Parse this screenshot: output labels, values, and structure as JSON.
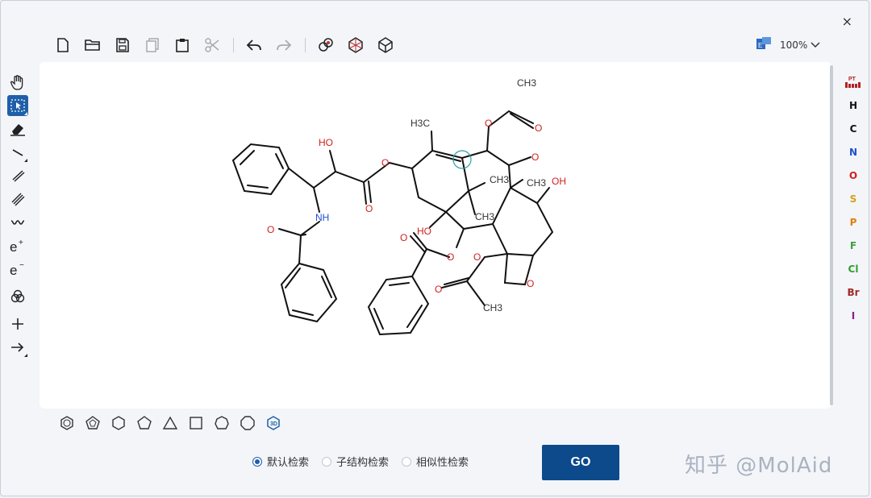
{
  "window": {
    "close_symbol": "×"
  },
  "toolbar": {
    "icons": [
      "new-file-icon",
      "open-folder-icon",
      "save-icon",
      "copy-icon",
      "paste-icon",
      "cut-icon",
      "undo-icon",
      "redo-icon",
      "clean-structure-icon",
      "3d-view-icon",
      "3d-rotate-icon"
    ]
  },
  "zoom": {
    "value": "100%"
  },
  "left_tools": [
    "hand-pan",
    "select",
    "eraser",
    "single-bond",
    "double-bond",
    "triple-bond",
    "wavy-bond",
    "charge-plus",
    "charge-minus",
    "rings",
    "add",
    "arrow"
  ],
  "elements": [
    {
      "symbol": "PT",
      "color": "#b22222"
    },
    {
      "symbol": "H",
      "color": "#111111"
    },
    {
      "symbol": "C",
      "color": "#111111"
    },
    {
      "symbol": "N",
      "color": "#2050d0"
    },
    {
      "symbol": "O",
      "color": "#d02020"
    },
    {
      "symbol": "S",
      "color": "#d4a018"
    },
    {
      "symbol": "P",
      "color": "#e08010"
    },
    {
      "symbol": "F",
      "color": "#40a040"
    },
    {
      "symbol": "Cl",
      "color": "#30a030"
    },
    {
      "symbol": "Br",
      "color": "#a02828"
    },
    {
      "symbol": "I",
      "color": "#8a208a"
    }
  ],
  "molecule": {
    "labels": {
      "ch3_top": "CH3",
      "ch3_left": "H3C",
      "ch3_mid": "CH3",
      "ch3_mid2": "CH3",
      "ch3_right": "CH3",
      "ch3_bottom": "CH3",
      "ho_top": "HO",
      "ho_ring": "HO",
      "oh": "OH",
      "nh": "NH",
      "o": "O"
    }
  },
  "search": {
    "options": [
      "默认检索",
      "子结构检索",
      "相似性检索"
    ],
    "selected": 0,
    "go_label": "GO"
  },
  "watermark": "知乎 @MolAid"
}
